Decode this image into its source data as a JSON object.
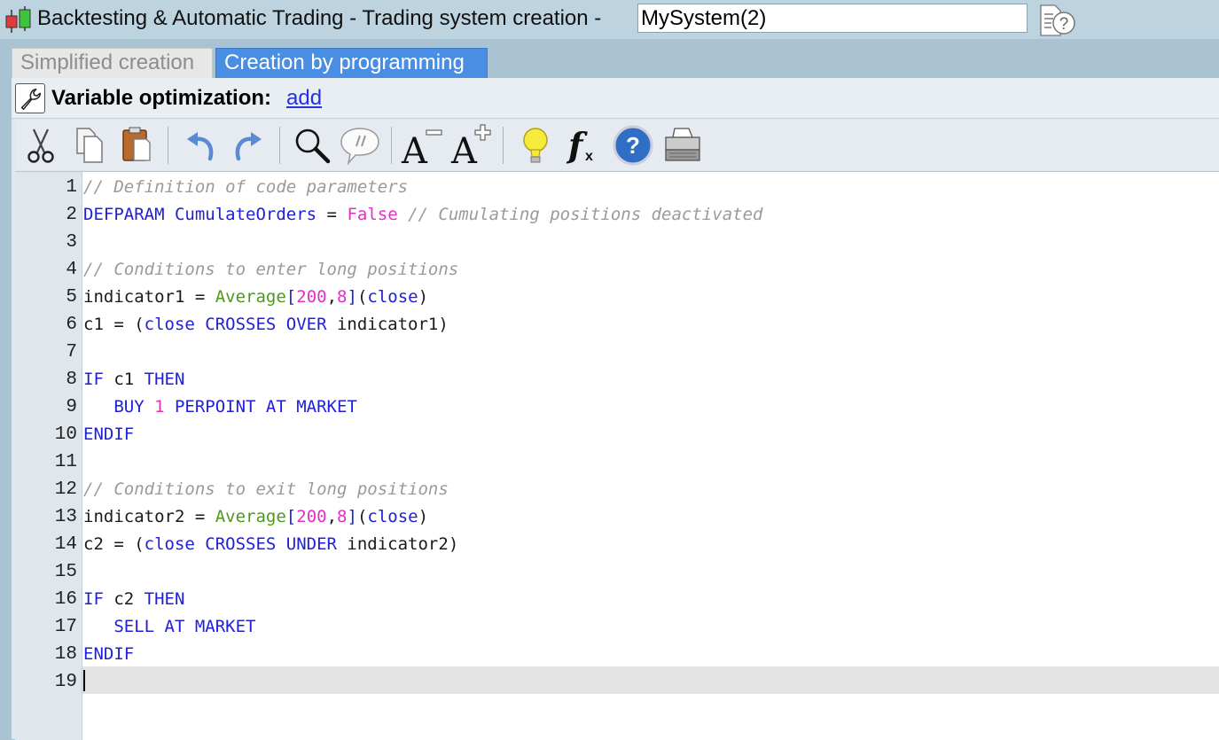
{
  "window": {
    "title": "Backtesting & Automatic Trading - Trading system creation -",
    "system_name": "MySystem(2)"
  },
  "tabs": [
    {
      "label": "Simplified creation",
      "active": false
    },
    {
      "label": "Creation by programming",
      "active": true
    }
  ],
  "optimization": {
    "label": "Variable optimization:",
    "add_link": "add"
  },
  "toolbar": {
    "buttons": [
      "cut-icon",
      "copy-icon",
      "paste-icon",
      "undo-icon",
      "redo-icon",
      "search-icon",
      "comment-icon",
      "font-decrease-icon",
      "font-increase-icon",
      "lightbulb-icon",
      "function-icon",
      "help-icon",
      "print-icon"
    ],
    "font_glyph": "A",
    "fx_glyph": "f",
    "fx_sub": "x",
    "help_glyph": "?"
  },
  "colors": {
    "active_tab": "#4a8ee3",
    "keyword": "#2020d8",
    "function": "#4d9a1a",
    "number": "#e230c2",
    "comment": "#9a9a9a"
  },
  "code": {
    "line_numbers": [
      "1",
      "2",
      "3",
      "4",
      "5",
      "6",
      "7",
      "8",
      "9",
      "10",
      "11",
      "12",
      "13",
      "14",
      "15",
      "16",
      "17",
      "18",
      "19"
    ],
    "lines": [
      [
        {
          "t": "// Definition of code parameters",
          "c": "comment"
        }
      ],
      [
        {
          "t": "DEFPARAM CumulateOrders",
          "c": "kw"
        },
        {
          "t": " = ",
          "c": "var"
        },
        {
          "t": "False",
          "c": "bool"
        },
        {
          "t": " // Cumulating positions deactivated",
          "c": "comment"
        }
      ],
      [],
      [
        {
          "t": "// Conditions to enter long positions",
          "c": "comment"
        }
      ],
      [
        {
          "t": "indicator1 = ",
          "c": "var"
        },
        {
          "t": "Average",
          "c": "fn"
        },
        {
          "t": "[",
          "c": "kw"
        },
        {
          "t": "200",
          "c": "num"
        },
        {
          "t": ",",
          "c": "var"
        },
        {
          "t": "8",
          "c": "num"
        },
        {
          "t": "]",
          "c": "kw"
        },
        {
          "t": "(",
          "c": "var"
        },
        {
          "t": "close",
          "c": "kw"
        },
        {
          "t": ")",
          "c": "var"
        }
      ],
      [
        {
          "t": "c1 = (",
          "c": "var"
        },
        {
          "t": "close CROSSES OVER",
          "c": "kw"
        },
        {
          "t": " indicator1)",
          "c": "var"
        }
      ],
      [],
      [
        {
          "t": "IF",
          "c": "kw"
        },
        {
          "t": " c1 ",
          "c": "var"
        },
        {
          "t": "THEN",
          "c": "kw"
        }
      ],
      [
        {
          "t": "   BUY ",
          "c": "kw"
        },
        {
          "t": "1",
          "c": "num"
        },
        {
          "t": " PERPOINT AT MARKET",
          "c": "kw"
        }
      ],
      [
        {
          "t": "ENDIF",
          "c": "kw"
        }
      ],
      [],
      [
        {
          "t": "// Conditions to exit long positions",
          "c": "comment"
        }
      ],
      [
        {
          "t": "indicator2 = ",
          "c": "var"
        },
        {
          "t": "Average",
          "c": "fn"
        },
        {
          "t": "[",
          "c": "kw"
        },
        {
          "t": "200",
          "c": "num"
        },
        {
          "t": ",",
          "c": "var"
        },
        {
          "t": "8",
          "c": "num"
        },
        {
          "t": "]",
          "c": "kw"
        },
        {
          "t": "(",
          "c": "var"
        },
        {
          "t": "close",
          "c": "kw"
        },
        {
          "t": ")",
          "c": "var"
        }
      ],
      [
        {
          "t": "c2 = (",
          "c": "var"
        },
        {
          "t": "close CROSSES UNDER",
          "c": "kw"
        },
        {
          "t": " indicator2)",
          "c": "var"
        }
      ],
      [],
      [
        {
          "t": "IF",
          "c": "kw"
        },
        {
          "t": " c2 ",
          "c": "var"
        },
        {
          "t": "THEN",
          "c": "kw"
        }
      ],
      [
        {
          "t": "   SELL AT MARKET",
          "c": "kw"
        }
      ],
      [
        {
          "t": "ENDIF",
          "c": "kw"
        }
      ],
      []
    ]
  }
}
